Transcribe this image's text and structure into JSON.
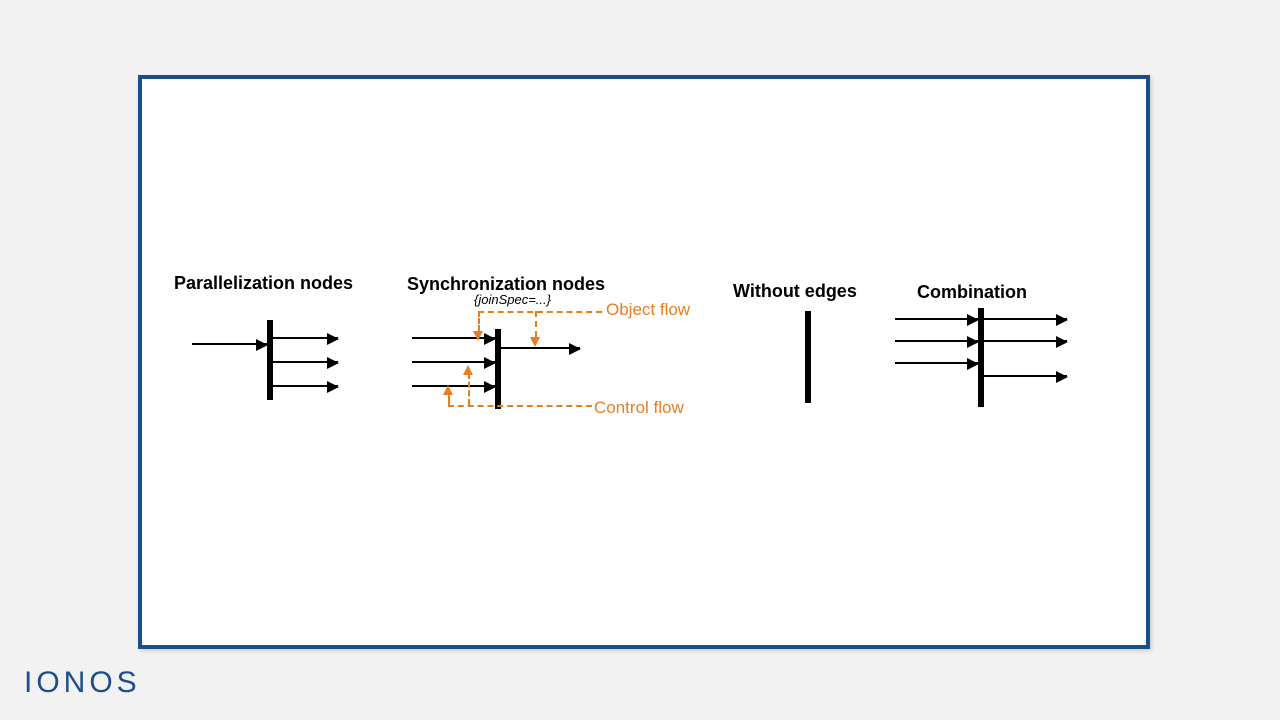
{
  "logo": "IONOS",
  "colors": {
    "frame_border": "#1a4f8b",
    "accent": "#e67e22"
  },
  "panels": {
    "parallelization": {
      "title": "Parallelization nodes"
    },
    "synchronization": {
      "title": "Synchronization nodes",
      "join_spec": "{joinSpec=...}",
      "object_flow": "Object flow",
      "control_flow": "Control flow"
    },
    "without_edges": {
      "title": "Without edges"
    },
    "combination": {
      "title": "Combination"
    }
  }
}
